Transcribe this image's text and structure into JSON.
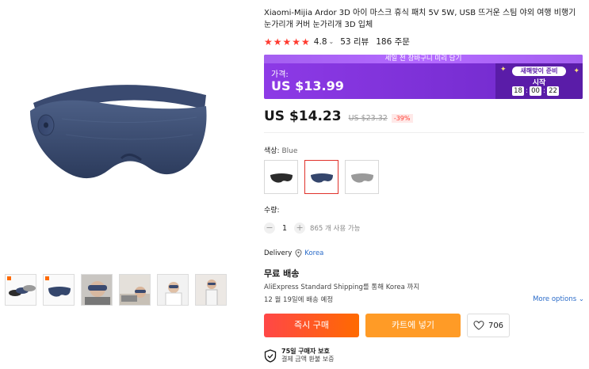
{
  "product": {
    "title": "Xiaomi-Mijia Ardor 3D 아이 마스크 휴식 패치 5V 5W, USB 뜨거운 스팀 야외 여행 비행기 눈가리개 커버 눈가리개 3D 입체",
    "rating_stars": "★★★★★",
    "rating_score": "4.8",
    "reviews": "53 리뷰",
    "orders": "186 주문"
  },
  "promo": {
    "banner": "세일 전 장바구니 미리 담기",
    "price_label": "가격:",
    "price": "US $13.99",
    "countdown_label": "새해맞이 준비",
    "countdown_start": "시작",
    "countdown": {
      "hours": "18",
      "minutes": "00",
      "seconds": "22"
    },
    "colors": {
      "bg": "#7b2fd6",
      "countdown_bg": "#5a1ca8"
    }
  },
  "pricing": {
    "current": "US $14.23",
    "original": "US $23.32",
    "discount": "-39%"
  },
  "color": {
    "label": "색상:",
    "value": "Blue",
    "options": [
      "black-mask",
      "blue-mask",
      "grey-mask"
    ],
    "selected_index": 1
  },
  "quantity": {
    "label": "수량:",
    "value": "1",
    "minus": "−",
    "plus": "+",
    "available": "865 개 사용 가능"
  },
  "delivery": {
    "label": "Delivery",
    "location": "Korea"
  },
  "shipping": {
    "title": "무료 배송",
    "method": "AliExpress Standard Shipping를 통해 Korea 까지",
    "eta": "12 월 19일에 배송 예정",
    "more_options": "More options"
  },
  "actions": {
    "buy_now": "즉시 구매",
    "add_to_cart": "카트에 넣기",
    "wishlist_count": "706"
  },
  "protection": {
    "title": "75일 구매자 보호",
    "subtitle": "결제 금액 환불 보증"
  },
  "thumbnails": [
    "three-masks",
    "blue-mask",
    "person-wearing",
    "person-lying",
    "person-relaxing",
    "person-standing"
  ],
  "accent_colors": {
    "primary": "#ff4747",
    "cart": "#ff9b26",
    "link": "#2a6bc9"
  }
}
